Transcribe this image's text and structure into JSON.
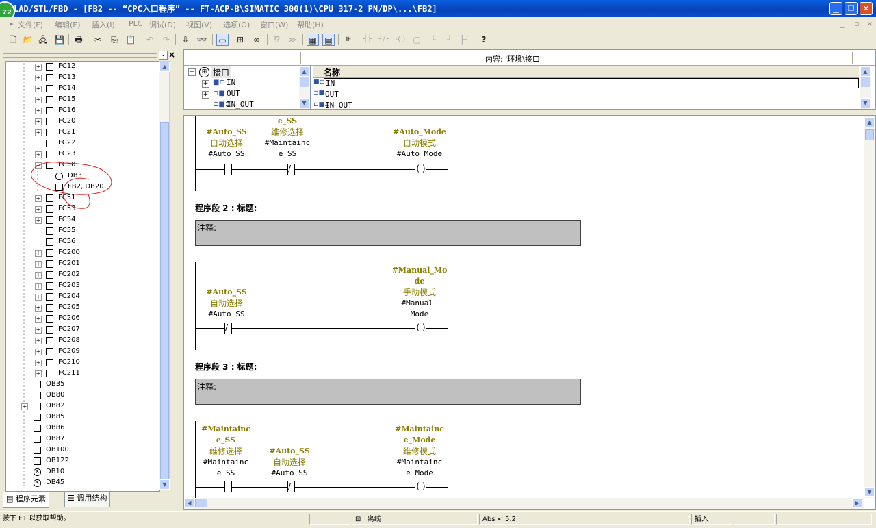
{
  "window": {
    "title": "LAD/STL/FBD  - [FB2 -- “CPC入口程序” -- FT-ACP-B\\SIMATIC 300(1)\\CPU 317-2 PN/DP\\...\\FB2]",
    "badge": "72",
    "minimize": "▁",
    "restore": "❐",
    "close": "✕"
  },
  "menu": {
    "items": [
      "文件(F)",
      "编辑(E)",
      "插入(I)",
      "PLC",
      "调试(D)",
      "视图(V)",
      "选项(O)",
      "窗口(W)",
      "帮助(H)"
    ],
    "mdi_min": "_",
    "mdi_restore": "▫",
    "mdi_close": "×"
  },
  "toolbar": {
    "new": "🗋",
    "open": "📂",
    "access": "🖧",
    "save": "💾",
    "print": "🖶",
    "cut": "✂",
    "copy": "⎘",
    "paste": "📋",
    "undo": "↶",
    "redo": "↷",
    "download": "⇩",
    "monitor": "👓",
    "overview": "▭",
    "network": "⊞",
    "glasses": "∞",
    "branch_open": "⁉",
    "branch_close": "≫",
    "contact_no": "┤├",
    "contact_nc": "┤/├",
    "coil": "-( )",
    "box": "▢",
    "jump_open": "└",
    "jump_close": "┘",
    "connection": "├┤",
    "help": "?"
  },
  "left": {
    "tree": [
      {
        "label": "FC12",
        "exp": "+"
      },
      {
        "label": "FC13",
        "exp": "+"
      },
      {
        "label": "FC14",
        "exp": "+"
      },
      {
        "label": "FC15",
        "exp": "+"
      },
      {
        "label": "FC16",
        "exp": "+"
      },
      {
        "label": "FC20",
        "exp": "+"
      },
      {
        "label": "FC21",
        "exp": "+"
      },
      {
        "label": "FC22",
        "exp": ""
      },
      {
        "label": "FC23",
        "exp": "+"
      },
      {
        "label": "FC50",
        "exp": "−"
      },
      {
        "label": "DB3",
        "exp": "",
        "child": true,
        "db": true
      },
      {
        "label": "FB2, DB20",
        "exp": "",
        "child": true
      },
      {
        "label": "FC51",
        "exp": "+"
      },
      {
        "label": "FC53",
        "exp": "+"
      },
      {
        "label": "FC54",
        "exp": "+"
      },
      {
        "label": "FC55",
        "exp": ""
      },
      {
        "label": "FC56",
        "exp": ""
      },
      {
        "label": "FC200",
        "exp": "+"
      },
      {
        "label": "FC201",
        "exp": "+"
      },
      {
        "label": "FC202",
        "exp": "+"
      },
      {
        "label": "FC203",
        "exp": "+"
      },
      {
        "label": "FC204",
        "exp": "+"
      },
      {
        "label": "FC205",
        "exp": "+"
      },
      {
        "label": "FC206",
        "exp": "+"
      },
      {
        "label": "FC207",
        "exp": "+"
      },
      {
        "label": "FC208",
        "exp": "+"
      },
      {
        "label": "FC209",
        "exp": "+"
      },
      {
        "label": "FC210",
        "exp": "+"
      },
      {
        "label": "FC211",
        "exp": "+"
      },
      {
        "label": "OB35",
        "exp": "",
        "ob": true
      },
      {
        "label": "OB80",
        "exp": "",
        "ob": true
      },
      {
        "label": "OB82",
        "exp": "+",
        "ob": true
      },
      {
        "label": "OB85",
        "exp": "",
        "ob": true
      },
      {
        "label": "OB86",
        "exp": "",
        "ob": true
      },
      {
        "label": "OB87",
        "exp": "",
        "ob": true
      },
      {
        "label": "OB100",
        "exp": "",
        "ob": true
      },
      {
        "label": "OB122",
        "exp": "",
        "ob": true
      },
      {
        "label": "DB10",
        "exp": "",
        "ob": true,
        "x": true
      },
      {
        "label": "DB45",
        "exp": "",
        "ob": true,
        "x": true
      }
    ],
    "tab_elements": "程序元素",
    "tab_structure": "调用结构",
    "close": "×"
  },
  "interface": {
    "content_label": "内容:  '环境\\接口'",
    "root": "接口",
    "tree": [
      "IN",
      "OUT",
      "IN_OUT"
    ],
    "col_name": "名称",
    "rows": [
      "IN",
      "OUT",
      "IN_OUT"
    ]
  },
  "networks": {
    "n1": {
      "c1_sym": "#Auto_SS",
      "c1_cmt": "自动选择",
      "c1_addr": "#Auto_SS",
      "c2_sym_top": "e_SS",
      "c2_cmt": "维修选择",
      "c2_addr1": "#Maintainc",
      "c2_addr2": "e_SS",
      "coil_sym": "#Auto_Mode",
      "coil_cmt": "自动模式",
      "coil_addr": "#Auto_Mode"
    },
    "n2": {
      "title": "程序段 2 : 标题:",
      "comment": "注释:",
      "c1_sym": "#Auto_SS",
      "c1_cmt": "自动选择",
      "c1_addr": "#Auto_SS",
      "coil_sym1": "#Manual_Mo",
      "coil_sym2": "de",
      "coil_cmt": "手动模式",
      "coil_addr1": "#Manual_",
      "coil_addr2": "Mode"
    },
    "n3": {
      "title": "程序段 3 : 标题:",
      "comment": "注释:",
      "c1_sym1": "#Maintainc",
      "c1_sym2": "e_SS",
      "c1_cmt": "维修选择",
      "c1_addr1": "#Maintainc",
      "c1_addr2": "e_SS",
      "c2_sym": "#Auto_SS",
      "c2_cmt": "自动选择",
      "c2_addr": "#Auto_SS",
      "coil_sym1": "#Maintainc",
      "coil_sym2": "e_Mode",
      "coil_cmt": "维修模式",
      "coil_addr1": "#Maintainc",
      "coil_addr2": "e_Mode"
    },
    "coil_glyph": "( )",
    "nc_glyph": "/"
  },
  "status": {
    "help": "按下 F1 以获取帮助。",
    "mode": "离线",
    "version": "Abs < 5.2",
    "insert": "插入"
  },
  "colors": {
    "symbol": "#8b7d00",
    "comment_bg": "#c0c0c0",
    "annotation": "#e02020"
  }
}
